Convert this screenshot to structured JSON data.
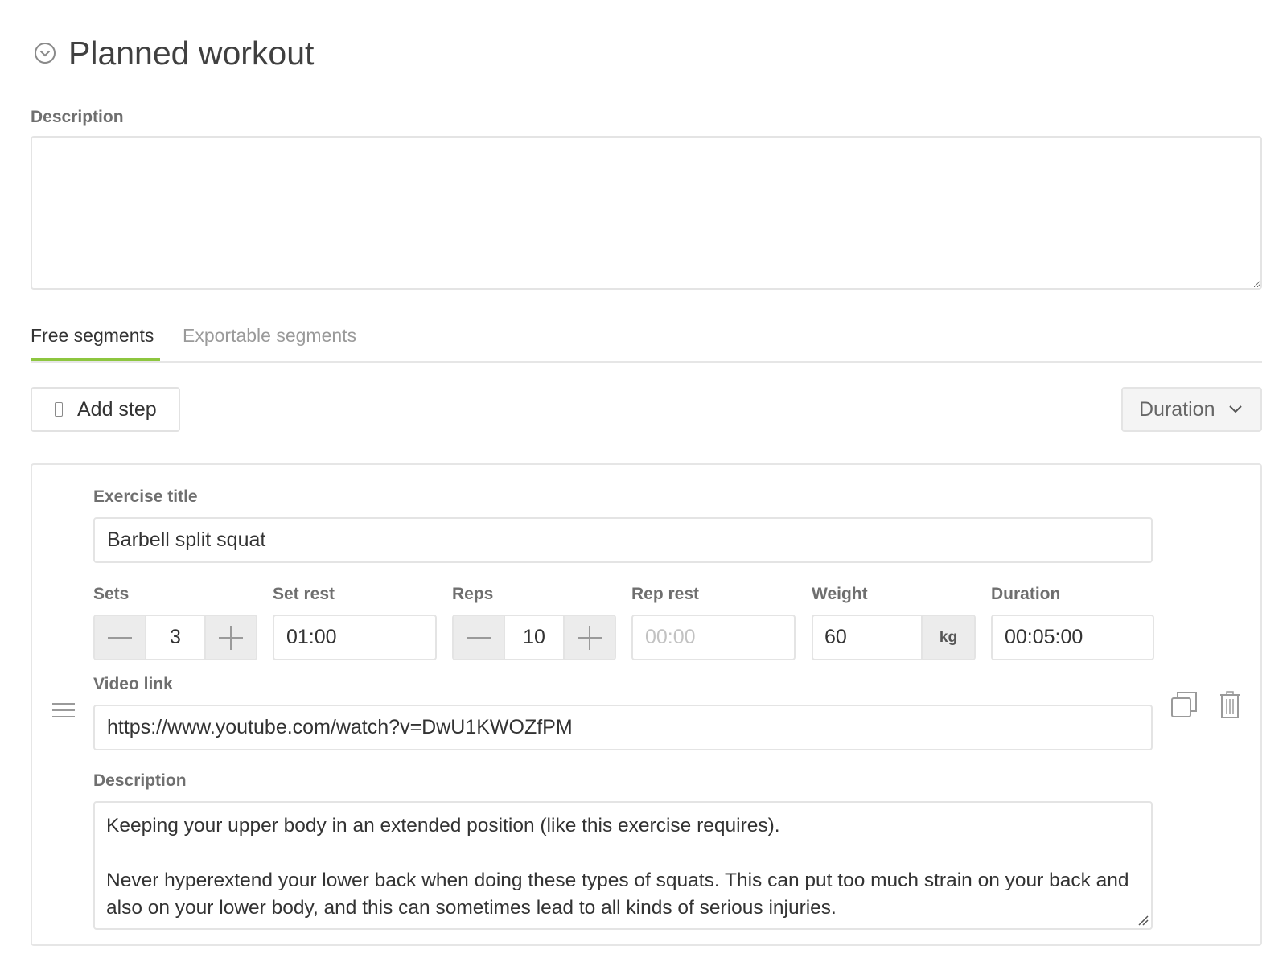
{
  "header": {
    "title": "Planned workout"
  },
  "description": {
    "label": "Description",
    "value": ""
  },
  "tabs": [
    {
      "label": "Free segments"
    },
    {
      "label": "Exportable segments"
    }
  ],
  "toolbar": {
    "add_step_label": "Add step",
    "mode_label": "Duration"
  },
  "exercise": {
    "title_label": "Exercise title",
    "title_value": "Barbell split squat",
    "sets": {
      "label": "Sets",
      "value": "3"
    },
    "set_rest": {
      "label": "Set rest",
      "value": "01:00"
    },
    "reps": {
      "label": "Reps",
      "value": "10"
    },
    "rep_rest": {
      "label": "Rep rest",
      "placeholder": "00:00"
    },
    "weight": {
      "label": "Weight",
      "value": "60",
      "unit": "kg"
    },
    "duration": {
      "label": "Duration",
      "value": "00:05:00"
    },
    "video_label": "Video link",
    "video_value": "https://www.youtube.com/watch?v=DwU1KWOZfPM",
    "desc_label": "Description",
    "desc_paragraphs": [
      "Keeping your upper body in an extended position (like this exercise requires).",
      "Never hyperextend your lower back when doing these types of squats. This can put too much strain on your back and also on your lower body, and this can sometimes lead to all kinds of serious injuries."
    ]
  },
  "colors": {
    "accent": "#8dc63f",
    "border": "#e4e4e4",
    "muted": "#9a9a9a"
  },
  "icons": [
    "chevron-circle-icon",
    "plus-icon",
    "chevron-down-icon",
    "drag-handle-icon",
    "copy-icon",
    "trash-icon",
    "minus-icon"
  ]
}
